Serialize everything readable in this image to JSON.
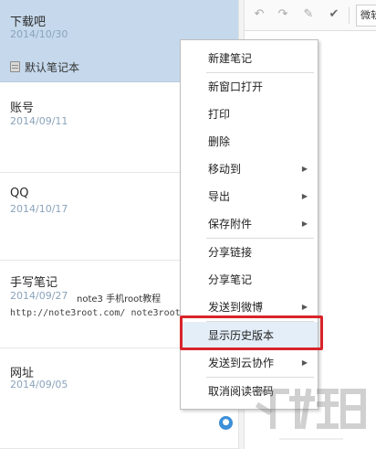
{
  "note_list": {
    "notes": [
      {
        "title": "下载吧",
        "date": "2014/10/30",
        "notebook": "默认笔记本",
        "selected": true
      },
      {
        "title": "账号",
        "date": "2014/09/11"
      },
      {
        "title": "QQ",
        "date": "2014/10/17"
      },
      {
        "title": "手写笔记",
        "date": "2014/09/27",
        "snippet_inline": "note3 手机root教程",
        "snippet": "http://note3root.com/ note3root"
      },
      {
        "title": "网址",
        "date": "2014/09/05",
        "lock_icon": "lock-icon"
      }
    ]
  },
  "toolbar": {
    "icons": [
      "undo-icon",
      "redo-icon",
      "format-brush-icon",
      "checkmark-icon"
    ],
    "font_value": "微软"
  },
  "context_menu": {
    "items": [
      {
        "label": "新建笔记"
      },
      {
        "label": "新窗口打开"
      },
      {
        "label": "打印"
      },
      {
        "label": "删除"
      },
      {
        "label": "移动到",
        "submenu": true
      },
      {
        "label": "导出",
        "submenu": true
      },
      {
        "label": "保存附件",
        "submenu": true
      },
      {
        "label": "分享链接"
      },
      {
        "label": "分享笔记"
      },
      {
        "label": "发送到微博",
        "submenu": true
      },
      {
        "label": "显示历史版本",
        "highlighted": true
      },
      {
        "label": "发送到云协作",
        "submenu": true
      },
      {
        "label": "取消阅读密码"
      }
    ],
    "submenu_arrow": "▶"
  },
  "colors": {
    "selected_note_bg": "#c6d9ec",
    "date_text": "#8aa3bb",
    "highlight_border": "#d9242a",
    "menu_hover_bg": "#e4eef8",
    "lock_badge": "#3d8fd8"
  }
}
